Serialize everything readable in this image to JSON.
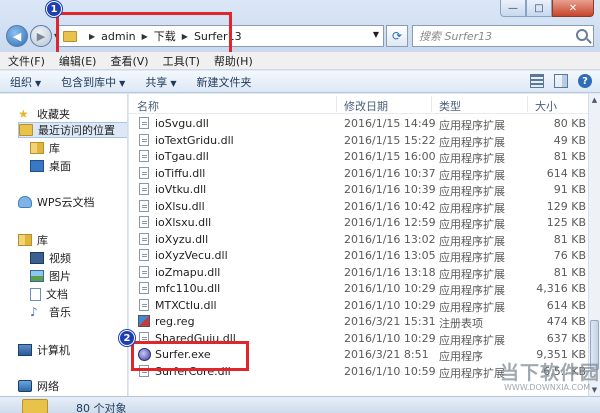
{
  "window": {
    "minimize": "—",
    "maximize": "□",
    "close": "✕"
  },
  "address": {
    "crumbs": [
      "admin",
      "下载",
      "Surfer13"
    ]
  },
  "search": {
    "placeholder": "搜索 Surfer13"
  },
  "badges": [
    "1",
    "2"
  ],
  "menu": [
    "文件(F)",
    "编辑(E)",
    "查看(V)",
    "工具(T)",
    "帮助(H)"
  ],
  "toolbar": {
    "organize": "组织",
    "include": "包含到库中",
    "share": "共享",
    "new_folder": "新建文件夹"
  },
  "sidebar": {
    "favorites": "收藏夹",
    "recent": "最近访问的位置",
    "library_fav": "库",
    "desktop": "桌面",
    "wps": "WPS云文档",
    "libraries": "库",
    "video": "视频",
    "pictures": "图片",
    "documents": "文档",
    "music": "音乐",
    "computer": "计算机",
    "network": "网络"
  },
  "columns": {
    "name": "名称",
    "date": "修改日期",
    "type": "类型",
    "size": "大小"
  },
  "files": [
    {
      "name": "ioSvgu.dll",
      "date": "2016/1/15 14:49",
      "type": "应用程序扩展",
      "size": "80 KB",
      "kind": "dll"
    },
    {
      "name": "ioTextGridu.dll",
      "date": "2016/1/15 15:22",
      "type": "应用程序扩展",
      "size": "49 KB",
      "kind": "dll"
    },
    {
      "name": "ioTgau.dll",
      "date": "2016/1/15 16:00",
      "type": "应用程序扩展",
      "size": "81 KB",
      "kind": "dll"
    },
    {
      "name": "ioTiffu.dll",
      "date": "2016/1/16 10:37",
      "type": "应用程序扩展",
      "size": "614 KB",
      "kind": "dll"
    },
    {
      "name": "ioVtku.dll",
      "date": "2016/1/16 10:39",
      "type": "应用程序扩展",
      "size": "91 KB",
      "kind": "dll"
    },
    {
      "name": "ioXlsu.dll",
      "date": "2016/1/16 10:42",
      "type": "应用程序扩展",
      "size": "129 KB",
      "kind": "dll"
    },
    {
      "name": "ioXlsxu.dll",
      "date": "2016/1/16 12:59",
      "type": "应用程序扩展",
      "size": "125 KB",
      "kind": "dll"
    },
    {
      "name": "ioXyzu.dll",
      "date": "2016/1/16 13:02",
      "type": "应用程序扩展",
      "size": "81 KB",
      "kind": "dll"
    },
    {
      "name": "ioXyzVecu.dll",
      "date": "2016/1/16 13:05",
      "type": "应用程序扩展",
      "size": "76 KB",
      "kind": "dll"
    },
    {
      "name": "ioZmapu.dll",
      "date": "2016/1/16 13:18",
      "type": "应用程序扩展",
      "size": "81 KB",
      "kind": "dll"
    },
    {
      "name": "mfc110u.dll",
      "date": "2016/1/10 10:29",
      "type": "应用程序扩展",
      "size": "4,316 KB",
      "kind": "dll"
    },
    {
      "name": "MTXCtlu.dll",
      "date": "2016/1/10 10:29",
      "type": "应用程序扩展",
      "size": "614 KB",
      "kind": "dll"
    },
    {
      "name": "reg.reg",
      "date": "2016/3/21 15:31",
      "type": "注册表项",
      "size": "474 KB",
      "kind": "reg"
    },
    {
      "name": "SharedGuiu.dll",
      "date": "2016/1/10 10:29",
      "type": "应用程序扩展",
      "size": "637 KB",
      "kind": "dll"
    },
    {
      "name": "Surfer.exe",
      "date": "2016/3/21 8:51",
      "type": "应用程序",
      "size": "9,351 KB",
      "kind": "exe"
    },
    {
      "name": "SurferCore.dll",
      "date": "2016/1/10 10:59",
      "type": "应用程序扩展",
      "size": "6,5.. KB",
      "kind": "dll"
    }
  ],
  "status": {
    "count": "80 个对象"
  },
  "watermark": {
    "main": "当下软件园",
    "sub": "WWW.DOWNXIA.COM"
  }
}
